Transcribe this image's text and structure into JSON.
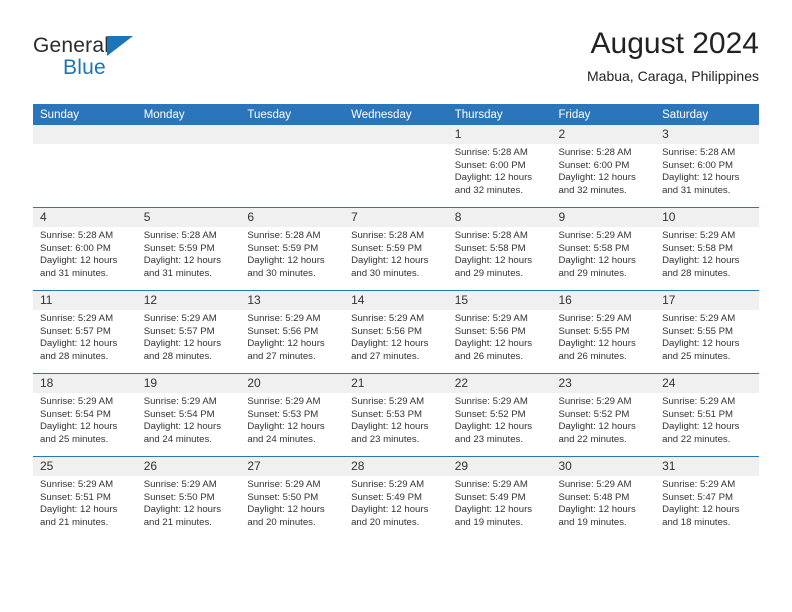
{
  "brand": {
    "name_top": "General",
    "name_bottom": "Blue",
    "accent_color": "#1b75bb"
  },
  "header": {
    "title": "August 2024",
    "subtitle": "Mabua, Caraga, Philippines"
  },
  "theme": {
    "header_row_color": "#2b76bb",
    "daynum_background": "#f0f0f0",
    "text_color": "#333333"
  },
  "weekdays": [
    "Sunday",
    "Monday",
    "Tuesday",
    "Wednesday",
    "Thursday",
    "Friday",
    "Saturday"
  ],
  "labels": {
    "sunrise_prefix": "Sunrise:",
    "sunset_prefix": "Sunset:",
    "daylight_prefix": "Daylight:"
  },
  "weeks": [
    [
      {
        "day": "",
        "blank": true
      },
      {
        "day": "",
        "blank": true
      },
      {
        "day": "",
        "blank": true
      },
      {
        "day": "",
        "blank": true
      },
      {
        "day": "1",
        "sunrise": "Sunrise: 5:28 AM",
        "sunset": "Sunset: 6:00 PM",
        "daylight": "Daylight: 12 hours and 32 minutes."
      },
      {
        "day": "2",
        "sunrise": "Sunrise: 5:28 AM",
        "sunset": "Sunset: 6:00 PM",
        "daylight": "Daylight: 12 hours and 32 minutes."
      },
      {
        "day": "3",
        "sunrise": "Sunrise: 5:28 AM",
        "sunset": "Sunset: 6:00 PM",
        "daylight": "Daylight: 12 hours and 31 minutes."
      }
    ],
    [
      {
        "day": "4",
        "sunrise": "Sunrise: 5:28 AM",
        "sunset": "Sunset: 6:00 PM",
        "daylight": "Daylight: 12 hours and 31 minutes."
      },
      {
        "day": "5",
        "sunrise": "Sunrise: 5:28 AM",
        "sunset": "Sunset: 5:59 PM",
        "daylight": "Daylight: 12 hours and 31 minutes."
      },
      {
        "day": "6",
        "sunrise": "Sunrise: 5:28 AM",
        "sunset": "Sunset: 5:59 PM",
        "daylight": "Daylight: 12 hours and 30 minutes."
      },
      {
        "day": "7",
        "sunrise": "Sunrise: 5:28 AM",
        "sunset": "Sunset: 5:59 PM",
        "daylight": "Daylight: 12 hours and 30 minutes."
      },
      {
        "day": "8",
        "sunrise": "Sunrise: 5:28 AM",
        "sunset": "Sunset: 5:58 PM",
        "daylight": "Daylight: 12 hours and 29 minutes."
      },
      {
        "day": "9",
        "sunrise": "Sunrise: 5:29 AM",
        "sunset": "Sunset: 5:58 PM",
        "daylight": "Daylight: 12 hours and 29 minutes."
      },
      {
        "day": "10",
        "sunrise": "Sunrise: 5:29 AM",
        "sunset": "Sunset: 5:58 PM",
        "daylight": "Daylight: 12 hours and 28 minutes."
      }
    ],
    [
      {
        "day": "11",
        "sunrise": "Sunrise: 5:29 AM",
        "sunset": "Sunset: 5:57 PM",
        "daylight": "Daylight: 12 hours and 28 minutes."
      },
      {
        "day": "12",
        "sunrise": "Sunrise: 5:29 AM",
        "sunset": "Sunset: 5:57 PM",
        "daylight": "Daylight: 12 hours and 28 minutes."
      },
      {
        "day": "13",
        "sunrise": "Sunrise: 5:29 AM",
        "sunset": "Sunset: 5:56 PM",
        "daylight": "Daylight: 12 hours and 27 minutes."
      },
      {
        "day": "14",
        "sunrise": "Sunrise: 5:29 AM",
        "sunset": "Sunset: 5:56 PM",
        "daylight": "Daylight: 12 hours and 27 minutes."
      },
      {
        "day": "15",
        "sunrise": "Sunrise: 5:29 AM",
        "sunset": "Sunset: 5:56 PM",
        "daylight": "Daylight: 12 hours and 26 minutes."
      },
      {
        "day": "16",
        "sunrise": "Sunrise: 5:29 AM",
        "sunset": "Sunset: 5:55 PM",
        "daylight": "Daylight: 12 hours and 26 minutes."
      },
      {
        "day": "17",
        "sunrise": "Sunrise: 5:29 AM",
        "sunset": "Sunset: 5:55 PM",
        "daylight": "Daylight: 12 hours and 25 minutes."
      }
    ],
    [
      {
        "day": "18",
        "sunrise": "Sunrise: 5:29 AM",
        "sunset": "Sunset: 5:54 PM",
        "daylight": "Daylight: 12 hours and 25 minutes."
      },
      {
        "day": "19",
        "sunrise": "Sunrise: 5:29 AM",
        "sunset": "Sunset: 5:54 PM",
        "daylight": "Daylight: 12 hours and 24 minutes."
      },
      {
        "day": "20",
        "sunrise": "Sunrise: 5:29 AM",
        "sunset": "Sunset: 5:53 PM",
        "daylight": "Daylight: 12 hours and 24 minutes."
      },
      {
        "day": "21",
        "sunrise": "Sunrise: 5:29 AM",
        "sunset": "Sunset: 5:53 PM",
        "daylight": "Daylight: 12 hours and 23 minutes."
      },
      {
        "day": "22",
        "sunrise": "Sunrise: 5:29 AM",
        "sunset": "Sunset: 5:52 PM",
        "daylight": "Daylight: 12 hours and 23 minutes."
      },
      {
        "day": "23",
        "sunrise": "Sunrise: 5:29 AM",
        "sunset": "Sunset: 5:52 PM",
        "daylight": "Daylight: 12 hours and 22 minutes."
      },
      {
        "day": "24",
        "sunrise": "Sunrise: 5:29 AM",
        "sunset": "Sunset: 5:51 PM",
        "daylight": "Daylight: 12 hours and 22 minutes."
      }
    ],
    [
      {
        "day": "25",
        "sunrise": "Sunrise: 5:29 AM",
        "sunset": "Sunset: 5:51 PM",
        "daylight": "Daylight: 12 hours and 21 minutes."
      },
      {
        "day": "26",
        "sunrise": "Sunrise: 5:29 AM",
        "sunset": "Sunset: 5:50 PM",
        "daylight": "Daylight: 12 hours and 21 minutes."
      },
      {
        "day": "27",
        "sunrise": "Sunrise: 5:29 AM",
        "sunset": "Sunset: 5:50 PM",
        "daylight": "Daylight: 12 hours and 20 minutes."
      },
      {
        "day": "28",
        "sunrise": "Sunrise: 5:29 AM",
        "sunset": "Sunset: 5:49 PM",
        "daylight": "Daylight: 12 hours and 20 minutes."
      },
      {
        "day": "29",
        "sunrise": "Sunrise: 5:29 AM",
        "sunset": "Sunset: 5:49 PM",
        "daylight": "Daylight: 12 hours and 19 minutes."
      },
      {
        "day": "30",
        "sunrise": "Sunrise: 5:29 AM",
        "sunset": "Sunset: 5:48 PM",
        "daylight": "Daylight: 12 hours and 19 minutes."
      },
      {
        "day": "31",
        "sunrise": "Sunrise: 5:29 AM",
        "sunset": "Sunset: 5:47 PM",
        "daylight": "Daylight: 12 hours and 18 minutes."
      }
    ]
  ]
}
